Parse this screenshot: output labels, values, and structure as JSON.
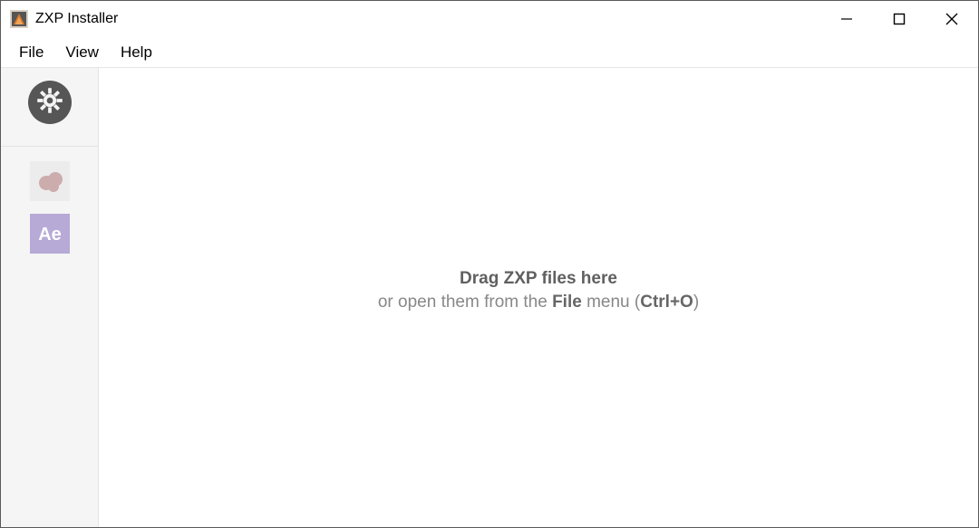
{
  "window": {
    "title": "ZXP Installer"
  },
  "menu": {
    "file": "File",
    "view": "View",
    "help": "Help"
  },
  "sidebar": {
    "apps": [
      {
        "name": "creative-cloud"
      },
      {
        "name": "after-effects",
        "label": "Ae"
      }
    ]
  },
  "drop": {
    "title": "Drag ZXP files here",
    "sub_prefix": "or open them from the ",
    "sub_bold1": "File",
    "sub_mid": " menu (",
    "sub_bold2": "Ctrl+O",
    "sub_suffix": ")"
  }
}
